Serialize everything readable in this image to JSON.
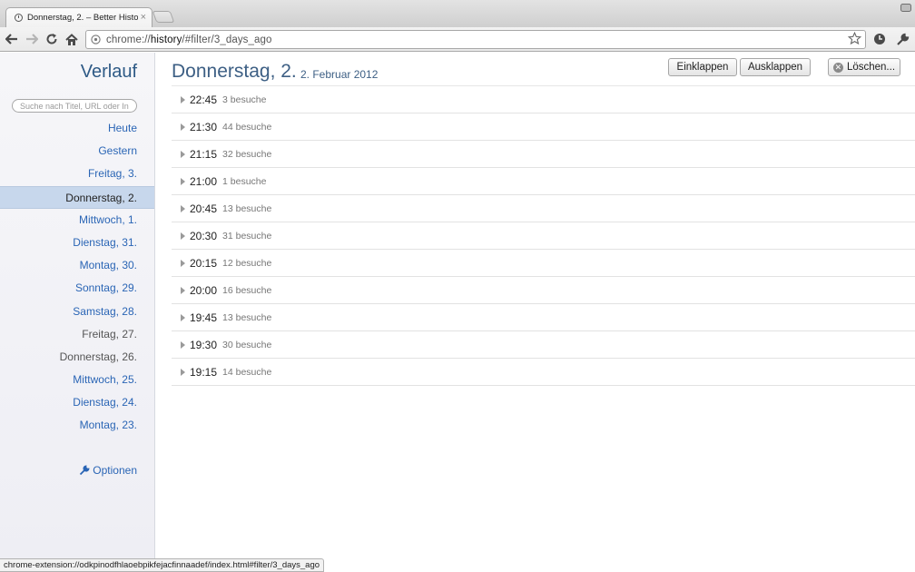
{
  "browser": {
    "tab_title": "Donnerstag, 2. – Better Histo",
    "url_scheme": "chrome://",
    "url_host": "history",
    "url_path": "/#filter/3_days_ago",
    "status_url": "chrome-extension://odkpinodfhlaoebpikfejacfinnaadef/index.html#filter/3_days_ago"
  },
  "sidebar": {
    "title": "Verlauf",
    "search_placeholder": "Suche nach Titel, URL oder Inhalt",
    "days": [
      {
        "label": "Heute",
        "state": "link"
      },
      {
        "label": "Gestern",
        "state": "link"
      },
      {
        "label": "Freitag, 3.",
        "state": "link"
      },
      {
        "label": "Donnerstag, 2.",
        "state": "selected"
      },
      {
        "label": "Mittwoch, 1.",
        "state": "link"
      },
      {
        "label": "Dienstag, 31.",
        "state": "link"
      },
      {
        "label": "Montag, 30.",
        "state": "link"
      },
      {
        "label": "Sonntag, 29.",
        "state": "link"
      },
      {
        "label": "Samstag, 28.",
        "state": "link"
      },
      {
        "label": "Freitag, 27.",
        "state": "muted"
      },
      {
        "label": "Donnerstag, 26.",
        "state": "muted"
      },
      {
        "label": "Mittwoch, 25.",
        "state": "link"
      },
      {
        "label": "Dienstag, 24.",
        "state": "link"
      },
      {
        "label": "Montag, 23.",
        "state": "link"
      }
    ],
    "options_label": "Optionen"
  },
  "main": {
    "title": "Donnerstag, 2.",
    "date": "2. Februar 2012",
    "buttons": {
      "collapse": "Einklappen",
      "expand": "Ausklappen",
      "delete": "Löschen..."
    },
    "intervals": [
      {
        "time": "22:45",
        "visits": "3 besuche"
      },
      {
        "time": "21:30",
        "visits": "44 besuche"
      },
      {
        "time": "21:15",
        "visits": "32 besuche"
      },
      {
        "time": "21:00",
        "visits": "1 besuche"
      },
      {
        "time": "20:45",
        "visits": "13 besuche"
      },
      {
        "time": "20:30",
        "visits": "31 besuche"
      },
      {
        "time": "20:15",
        "visits": "12 besuche"
      },
      {
        "time": "20:00",
        "visits": "16 besuche"
      },
      {
        "time": "19:45",
        "visits": "13 besuche"
      },
      {
        "time": "19:30",
        "visits": "30 besuche"
      },
      {
        "time": "19:15",
        "visits": "14 besuche"
      }
    ]
  },
  "colors": {
    "link": "#2a65b5",
    "heading": "#3d5f84",
    "selected_bg": "#c7d7ec"
  }
}
